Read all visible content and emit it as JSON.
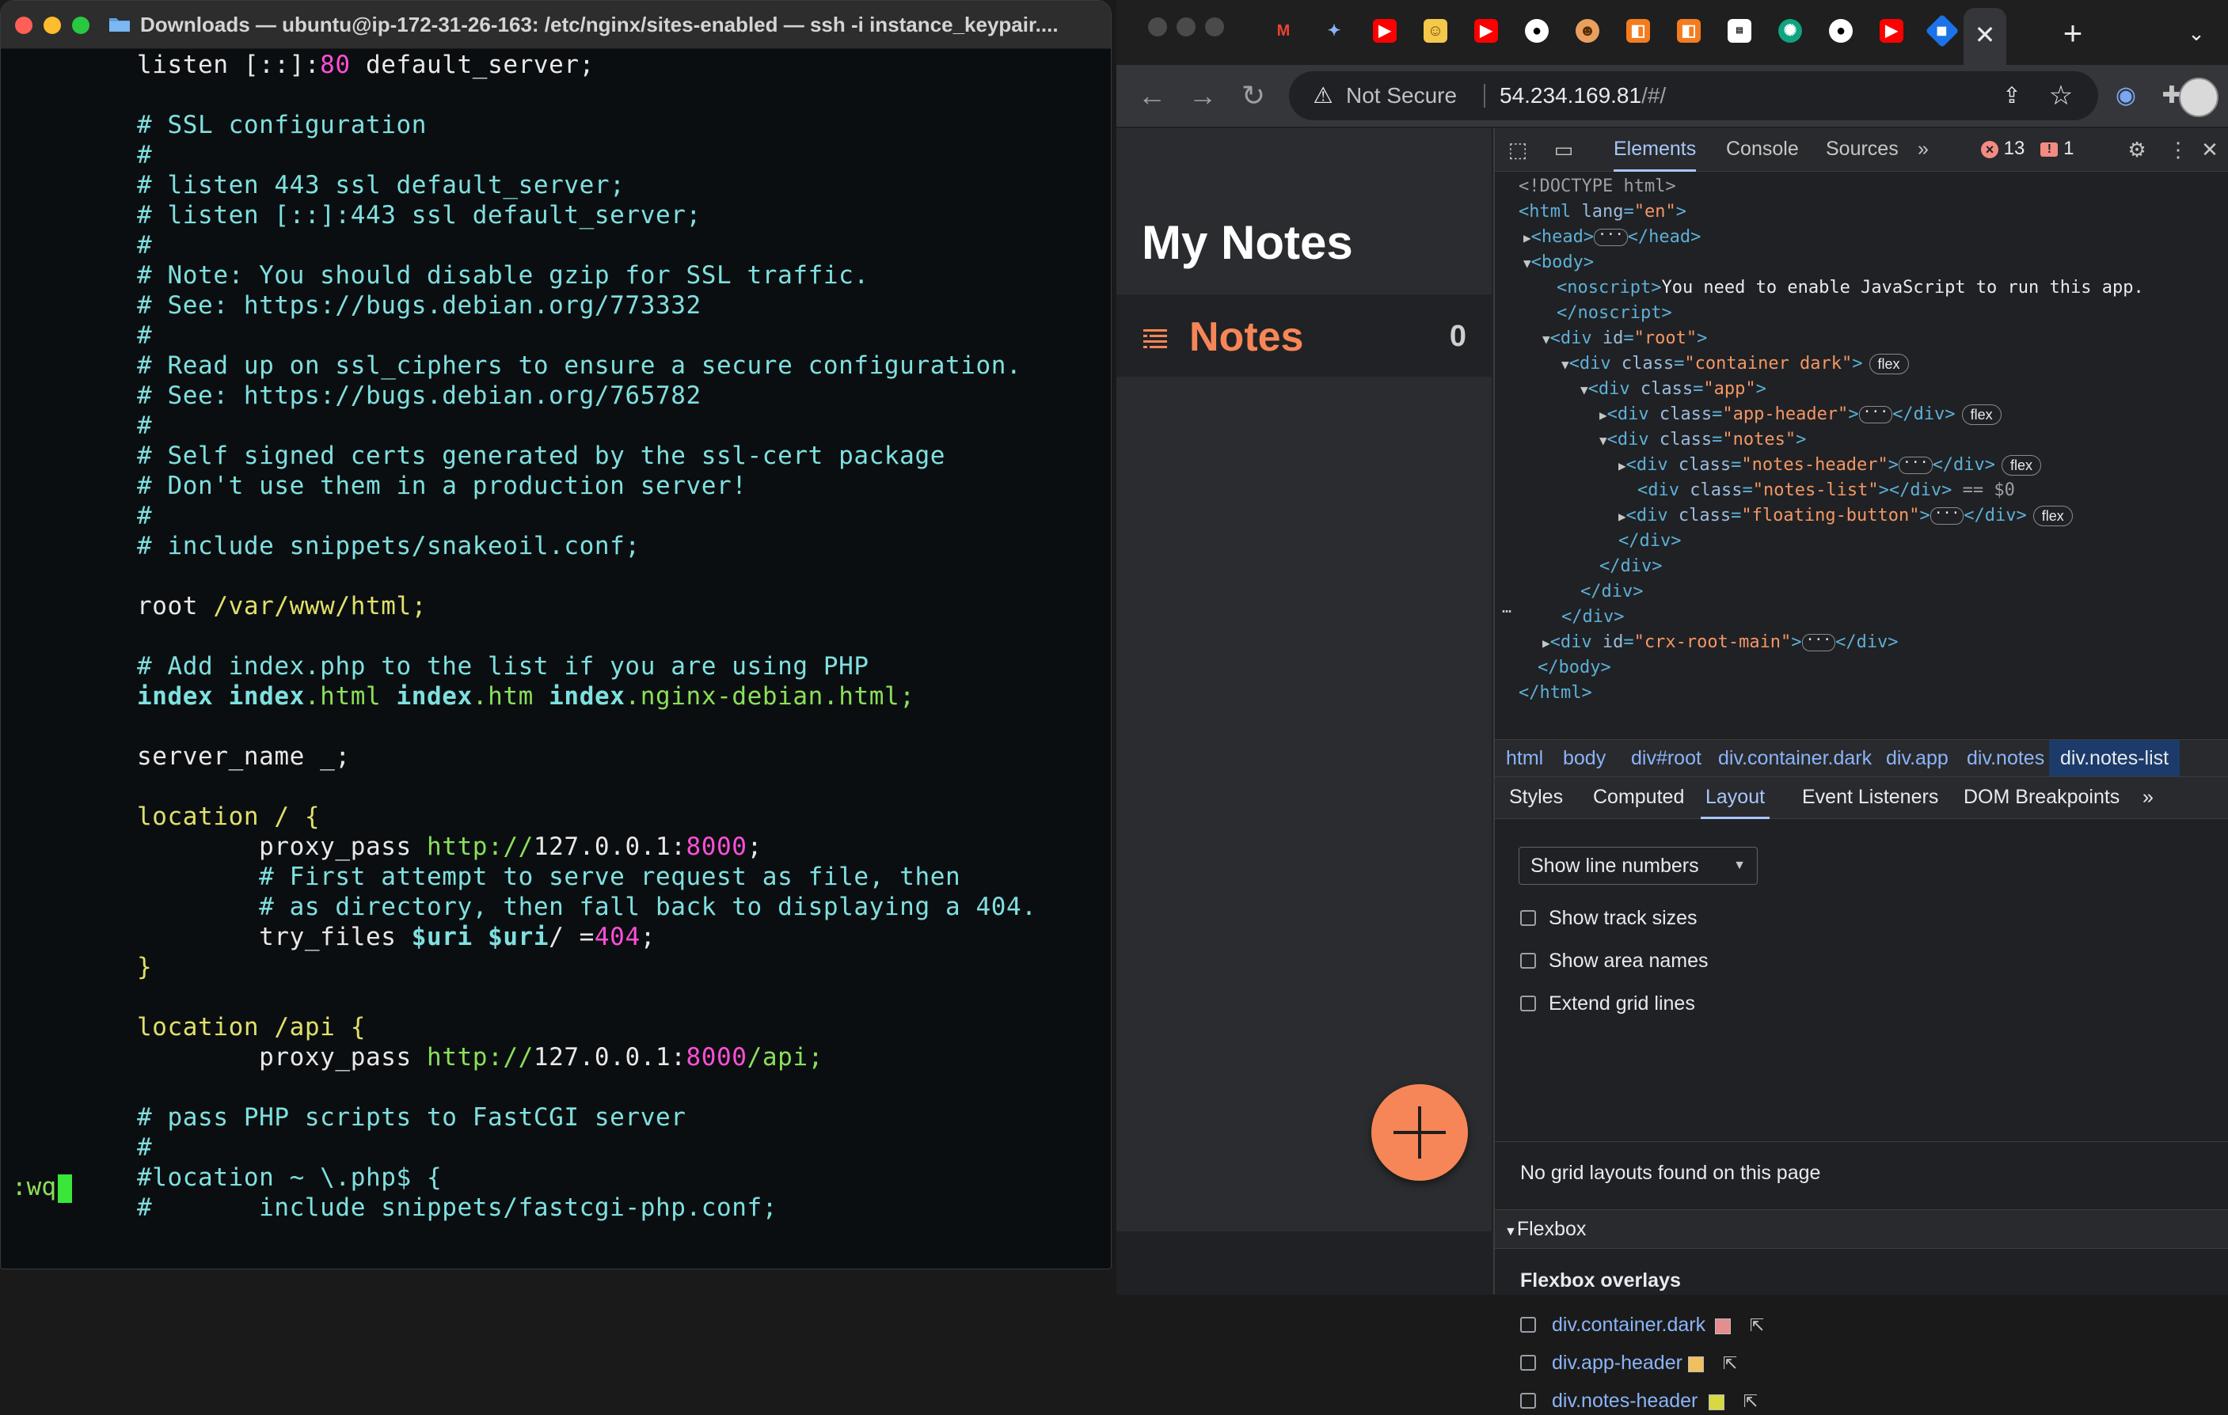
{
  "terminal": {
    "title": "Downloads — ubuntu@ip-172-31-26-163: /etc/nginx/sites-enabled — ssh -i instance_keypair....",
    "command_line": ":wq",
    "lines": [
      "listen [::]:80 default_server;",
      "",
      "# SSL configuration",
      "#",
      "# listen 443 ssl default_server;",
      "# listen [::]:443 ssl default_server;",
      "#",
      "# Note: You should disable gzip for SSL traffic.",
      "# See: https://bugs.debian.org/773332",
      "#",
      "# Read up on ssl_ciphers to ensure a secure configuration.",
      "# See: https://bugs.debian.org/765782",
      "#",
      "# Self signed certs generated by the ssl-cert package",
      "# Don't use them in a production server!",
      "#",
      "# include snippets/snakeoil.conf;",
      "",
      "root /var/www/html;",
      "",
      "# Add index.php to the list if you are using PHP",
      "index index.html index.htm index.nginx-debian.html;",
      "",
      "server_name _;",
      "",
      "location / {",
      "        proxy_pass http://127.0.0.1:8000;",
      "        # First attempt to serve request as file, then",
      "        # as directory, then fall back to displaying a 404.",
      "        try_files $uri $uri/ =404;",
      "}",
      "",
      "location /api {",
      "        proxy_pass http://127.0.0.1:8000/api;",
      "",
      "# pass PHP scripts to FastCGI server",
      "#",
      "#location ~ \\.php$ {",
      "#       include snippets/fastcgi-php.conf;"
    ]
  },
  "browser": {
    "address_bar": {
      "security_label": "Not Secure",
      "host": "54.234.169.81",
      "path": "/#/"
    },
    "tab_close_glyph": "✕",
    "new_tab_glyph": "+"
  },
  "app": {
    "title": "My Notes",
    "notes_header_title": "Notes",
    "notes_count": "0"
  },
  "devtools": {
    "tabs": [
      "Elements",
      "Console",
      "Sources"
    ],
    "more_tabs": "»",
    "errors_count": "13",
    "issues_count": "1",
    "dom": {
      "doctype": "<!DOCTYPE html>",
      "noscript_text": "You need to enable JavaScript to run this app.",
      "selected_marker": "== $0",
      "flex_badge": "flex"
    },
    "breadcrumbs": [
      "html",
      "body",
      "div#root",
      "div.container.dark",
      "div.app",
      "div.notes",
      "div.notes-list"
    ],
    "subtabs": [
      "Styles",
      "Computed",
      "Layout",
      "Event Listeners",
      "DOM Breakpoints"
    ],
    "layout": {
      "grid_select_value": "Show line numbers",
      "checkboxes": [
        "Show track sizes",
        "Show area names",
        "Extend grid lines"
      ],
      "no_grid_message": "No grid layouts found on this page",
      "flexbox_section": "Flexbox",
      "flexbox_overlays_title": "Flexbox overlays",
      "overlays": [
        {
          "label": "div.container.dark",
          "color": "#e58e8e"
        },
        {
          "label": "div.app-header",
          "color": "#f0c060"
        },
        {
          "label": "div.notes-header",
          "color": "#d8d840"
        }
      ]
    }
  },
  "colors": {
    "terminal_bg": "#0b0e10",
    "comment": "#7fe0e0",
    "keyword": "#e0e06a",
    "number": "#ff4fd8",
    "string": "#8be05a",
    "app_accent": "#f68657",
    "devtools_accent": "#a8c7fa"
  }
}
